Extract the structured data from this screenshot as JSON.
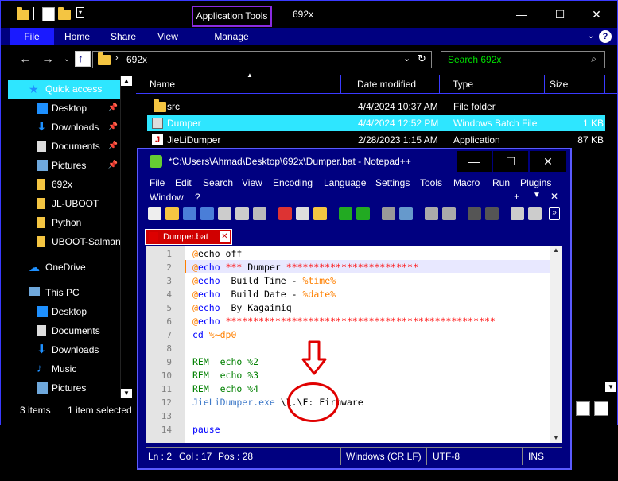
{
  "explorer": {
    "title": "692x",
    "contextual_tab": "Application Tools",
    "ribbon_tabs": [
      "File",
      "Home",
      "Share",
      "View",
      "Manage"
    ],
    "address_path": "692x",
    "search_placeholder": "Search 692x",
    "nav": {
      "items": [
        {
          "label": "Quick access",
          "icon": "star-icon",
          "pinned": false
        },
        {
          "label": "Desktop",
          "icon": "desktop-icon",
          "pinned": true
        },
        {
          "label": "Downloads",
          "icon": "download-icon",
          "pinned": true
        },
        {
          "label": "Documents",
          "icon": "documents-icon",
          "pinned": true
        },
        {
          "label": "Pictures",
          "icon": "pictures-icon",
          "pinned": true
        },
        {
          "label": "692x",
          "icon": "folder-icon",
          "pinned": false
        },
        {
          "label": "JL-UBOOT",
          "icon": "folder-icon",
          "pinned": false
        },
        {
          "label": "Python",
          "icon": "folder-icon",
          "pinned": false
        },
        {
          "label": "UBOOT-Salman",
          "icon": "folder-icon",
          "pinned": false
        },
        {
          "label": "OneDrive",
          "icon": "cloud-icon",
          "pinned": false
        },
        {
          "label": "This PC",
          "icon": "pc-icon",
          "pinned": false
        },
        {
          "label": "Desktop",
          "icon": "desktop-icon",
          "pinned": false
        },
        {
          "label": "Documents",
          "icon": "documents-icon",
          "pinned": false
        },
        {
          "label": "Downloads",
          "icon": "download-icon",
          "pinned": false
        },
        {
          "label": "Music",
          "icon": "music-icon",
          "pinned": false
        },
        {
          "label": "Pictures",
          "icon": "pictures-icon",
          "pinned": false
        }
      ]
    },
    "columns": [
      "Name",
      "Date modified",
      "Type",
      "Size"
    ],
    "files": [
      {
        "name": "src",
        "date": "4/4/2024 10:37 AM",
        "type": "File folder",
        "size": ""
      },
      {
        "name": "Dumper",
        "date": "4/4/2024 12:52 PM",
        "type": "Windows Batch File",
        "size": "1 KB"
      },
      {
        "name": "JieLiDumper",
        "date": "2/28/2023 1:15 AM",
        "type": "Application",
        "size": "87 KB"
      }
    ],
    "status": {
      "count": "3 items",
      "selected": "1 item selected"
    }
  },
  "npp": {
    "title": "*C:\\Users\\Ahmad\\Desktop\\692x\\Dumper.bat - Notepad++",
    "menu_row1": [
      "File",
      "Edit",
      "Search",
      "View",
      "Encoding",
      "Language",
      "Settings",
      "Tools",
      "Macro",
      "Run",
      "Plugins"
    ],
    "menu_row2": [
      "Window",
      "?"
    ],
    "tab_label": "Dumper.bat",
    "line_numbers": [
      "1",
      "2",
      "3",
      "4",
      "5",
      "6",
      "7",
      "8",
      "9",
      "10",
      "11",
      "12",
      "13",
      "14"
    ],
    "lines": {
      "l1_at": "@",
      "l1_rest": "echo off",
      "l2_at": "@",
      "l2_kw": "echo",
      "l2_stars": " *** ",
      "l2_txt": "Dumper ",
      "l2_stars2": "************************",
      "l3_at": "@",
      "l3_kw": "echo",
      "l3_txt": "  Build Time - ",
      "l3_var": "%time%",
      "l4_at": "@",
      "l4_kw": "echo",
      "l4_txt": "  Build Date - ",
      "l4_var": "%date%",
      "l5_at": "@",
      "l5_kw": "echo",
      "l5_txt": "  By Kagaimiq",
      "l6_at": "@",
      "l6_kw": "echo",
      "l6_stars": " *************************************************",
      "l7_kw": "cd",
      "l7_var": " %~dp0",
      "l9": "REM  echo %2",
      "l10": "REM  echo %3",
      "l11": "REM  echo %4",
      "l12_exe": "JieLiDumper.exe",
      "l12_arg": " \\\\.\\F: Firmware",
      "l14": "pause"
    },
    "status": {
      "ln": "Ln : 2",
      "col": "Col : 17",
      "pos": "Pos : 28",
      "eol": "Windows (CR LF)",
      "enc": "UTF-8",
      "mode": "INS"
    }
  },
  "colors": {
    "accent": "#2ee6ff",
    "ribbon": "#000080",
    "annotation": "#e00000"
  }
}
